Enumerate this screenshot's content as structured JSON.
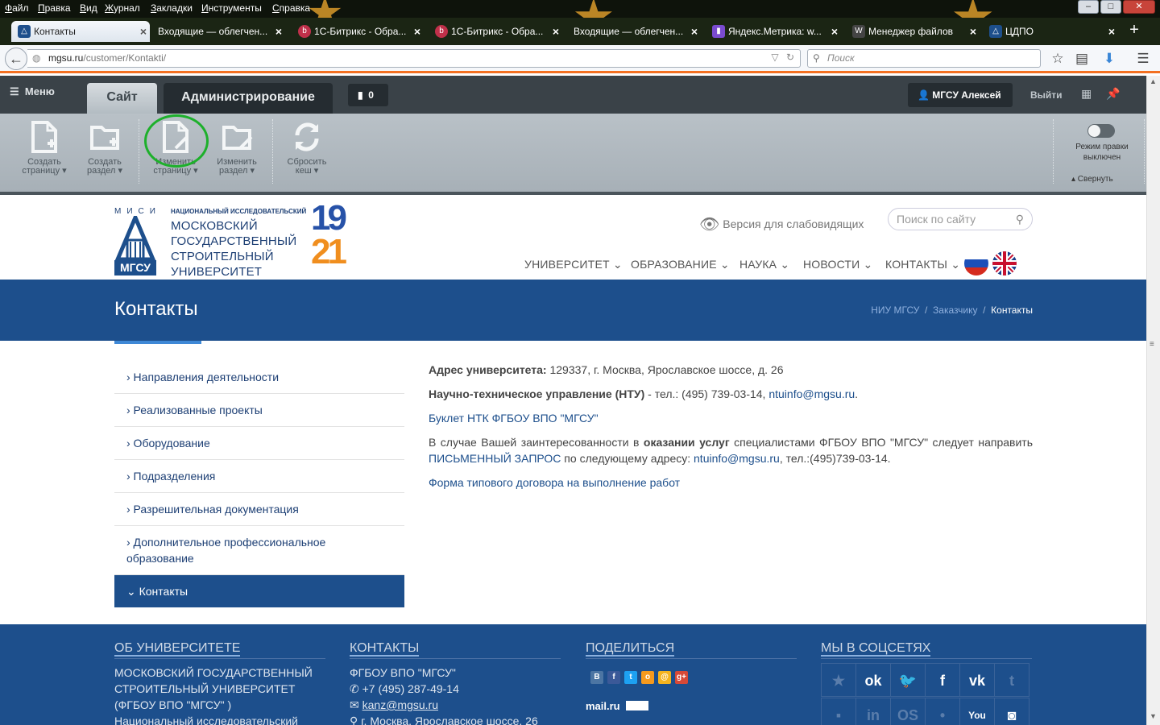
{
  "browser": {
    "menu": [
      "Файл",
      "Правка",
      "Вид",
      "Журнал",
      "Закладки",
      "Инструменты",
      "Справка"
    ],
    "window_controls": {
      "minimize": "–",
      "maximize": "□",
      "close": "✕"
    },
    "tabs": [
      {
        "label": "Контакты",
        "active": true
      },
      {
        "label": "Входящие — облегчен..."
      },
      {
        "label": "1С-Битрикс - Обра..."
      },
      {
        "label": "1С-Битрикс - Обра..."
      },
      {
        "label": "Входящие — облегчен..."
      },
      {
        "label": "Яндекс.Метрика: w..."
      },
      {
        "label": "Менеджер файлов"
      },
      {
        "label": "ЦДПО"
      }
    ],
    "close_tab": "×",
    "new_tab": "+",
    "url_host": "mgsu.ru",
    "url_path": "/customer/Kontakti/",
    "search_placeholder": "Поиск"
  },
  "admin": {
    "menu": "Меню",
    "tab_site": "Сайт",
    "tab_admin": "Администрирование",
    "notifications": "0",
    "user": "МГСУ Алексей",
    "logout": "Выйти",
    "tools": [
      {
        "line1": "Создать",
        "line2": "страницу ▾"
      },
      {
        "line1": "Создать",
        "line2": "раздел ▾"
      },
      {
        "line1": "Изменить",
        "line2": "страницу ▾"
      },
      {
        "line1": "Изменить",
        "line2": "раздел ▾"
      },
      {
        "line1": "Сбросить",
        "line2": "кеш ▾"
      }
    ],
    "edit_mode_line1": "Режим правки",
    "edit_mode_line2": "выключен",
    "collapse": "▴ Свернуть"
  },
  "site": {
    "logo_top": "НАЦИОНАЛЬНЫЙ ИССЛЕДОВАТЕЛЬСКИЙ",
    "logo_lines": [
      "МОСКОВСКИЙ",
      "ГОСУДАРСТВЕННЫЙ",
      "СТРОИТЕЛЬНЫЙ",
      "УНИВЕРСИТЕТ"
    ],
    "logo_mis": "МИСИ",
    "logo_abbr": "МГСУ",
    "year_top": "19",
    "year_bottom": "21",
    "vision": "Версия для слабовидящих",
    "search_placeholder": "Поиск по сайту",
    "nav": [
      "УНИВЕРСИТЕТ",
      "ОБРАЗОВАНИЕ",
      "НАУКА",
      "НОВОСТИ",
      "КОНТАКТЫ"
    ],
    "chevron": "⌄"
  },
  "page": {
    "title": "Контакты",
    "breadcrumb": [
      "НИУ МГСУ",
      "Заказчику",
      "Контакты"
    ],
    "breadcrumb_sep": "/"
  },
  "sidebar": {
    "items": [
      "› Направления деятельности",
      "› Реализованные проекты",
      "› Оборудование",
      "› Подразделения",
      "› Разрешительная документация",
      "› Дополнительное профессиональное образование"
    ],
    "active": "⌄ Контакты"
  },
  "content": {
    "address_label": "Адрес университета:",
    "address": " 129337, г. Москва, Ярославское шоссе, д. 26",
    "ntu_label": "Научно-техническое управление (НТУ)",
    "ntu_text": " - тел.: (495) 739-03-14, ",
    "ntu_email": "ntuinfo@mgsu.ru",
    "ntu_dot": ".",
    "booklet": "Буклет НТК ФГБОУ ВПО \"МГСУ\"",
    "p1_a": "В случае Вашей заинтересованности в ",
    "p1_b": "оказании услуг",
    "p1_c": " специалистами ФГБОУ ВПО \"МГСУ\" следует направить ",
    "p1_link": "ПИСЬМЕННЫЙ ЗАПРОС",
    "p1_d": " по следующему адресу: ",
    "p1_email": "ntuinfo@mgsu.ru",
    "p1_e": ", тел.:(495)739-03-14.",
    "contract": "Форма типового договора на выполнение работ"
  },
  "footer": {
    "col1_title": "ОБ УНИВЕРСИТЕТЕ",
    "col1_lines": [
      "МОСКОВСКИЙ ГОСУДАРСТВЕННЫЙ",
      "СТРОИТЕЛЬНЫЙ УНИВЕРСИТЕТ",
      "(ФГБОУ ВПО \"МГСУ\" )",
      "Национальный исследовательский"
    ],
    "col2_title": "КОНТАКТЫ",
    "col2_org": "ФГБОУ ВПО \"МГСУ\"",
    "col2_phone": "+7 (495) 287-49-14",
    "col2_email": "kanz@mgsu.ru",
    "col2_addr": "г. Москва, Ярославское шоссе, 26",
    "col3_title": "ПОДЕЛИТЬСЯ",
    "mailru": "mail.ru",
    "col4_title": "МЫ В СОЦСЕТЯХ"
  },
  "colors": {
    "accent": "#f37021",
    "brand": "#1d4f8c",
    "edit_highlight": "#1db02b"
  }
}
